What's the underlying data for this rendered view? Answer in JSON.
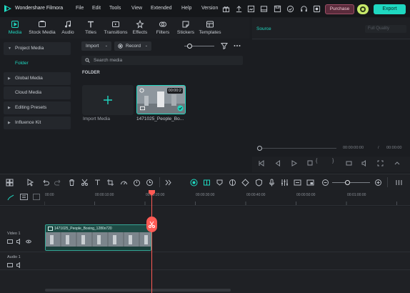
{
  "app": {
    "title": "Wondershare Filmora"
  },
  "menu": [
    "File",
    "Edit",
    "Tools",
    "View",
    "Extended",
    "Help",
    "Version"
  ],
  "header_buttons": {
    "purchase": "Purchase",
    "export": "Export"
  },
  "tabs": [
    {
      "label": "Media",
      "icon": "media-icon"
    },
    {
      "label": "Stock Media",
      "icon": "stock-media-icon"
    },
    {
      "label": "Audio",
      "icon": "audio-icon"
    },
    {
      "label": "Titles",
      "icon": "titles-icon"
    },
    {
      "label": "Transitions",
      "icon": "transitions-icon"
    },
    {
      "label": "Effects",
      "icon": "effects-icon"
    },
    {
      "label": "Filters",
      "icon": "filters-icon"
    },
    {
      "label": "Stickers",
      "icon": "stickers-icon"
    },
    {
      "label": "Templates",
      "icon": "templates-icon"
    }
  ],
  "sidebar": {
    "items": [
      {
        "label": "Project Media"
      },
      {
        "label": "Folder"
      },
      {
        "label": "Global Media"
      },
      {
        "label": "Cloud Media"
      },
      {
        "label": "Editing Presets"
      },
      {
        "label": "Influence Kit"
      }
    ]
  },
  "media": {
    "import_label": "Import",
    "record_label": "Record",
    "search_placeholder": "Search media",
    "folder_heading": "FOLDER",
    "import_card_label": "Import Media",
    "clip": {
      "name": "1471025_People_Bo...",
      "duration": "00:00:2"
    }
  },
  "preview": {
    "source_label": "Source",
    "quality": "Full Quality",
    "current_time": "00:00:00:00",
    "separator": "/",
    "total_time": "00:00:00"
  },
  "timeline": {
    "ticks": [
      "00:00",
      "00:00:10:00",
      "00:00:20:00",
      "00:00:30:00",
      "00:00:40:00",
      "00:00:50:00",
      "00:01:00:00"
    ],
    "tracks": [
      {
        "label": "Video 1"
      },
      {
        "label": "Audio 1"
      }
    ],
    "clip_title": "1471025_People_Boxing_1280x720"
  },
  "colors": {
    "accent": "#1fd8c1",
    "playhead": "#ff5b55",
    "purchase": "#5a2b3b"
  }
}
